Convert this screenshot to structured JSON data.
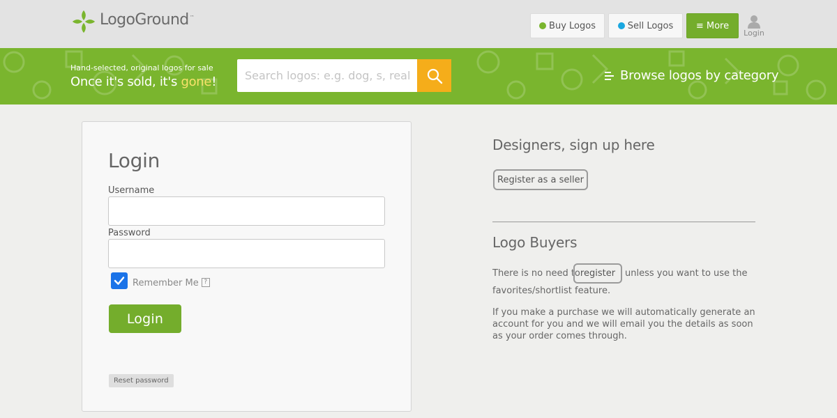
{
  "header": {
    "logo_text": "LogoGround",
    "logo_tm": "™",
    "nav": {
      "buy_label": "Buy Logos",
      "sell_label": "Sell Logos",
      "more_label": "≡ More",
      "login_label": "Login"
    }
  },
  "banner": {
    "tagline_small": "Hand-selected, original logos for sale",
    "tagline_prefix": "Once it's sold, it's ",
    "tagline_highlight": "gone",
    "tagline_suffix": "!",
    "search_placeholder": "Search logos: e.g. dog, s, real estate",
    "browse_label": "Browse logos by category"
  },
  "login_form": {
    "title": "Login",
    "username_label": "Username",
    "username_value": "",
    "password_label": "Password",
    "password_value": "",
    "remember_label": "Remember Me",
    "remember_checked": true,
    "help_symbol": "?",
    "submit_label": "Login",
    "reset_label": "Reset password"
  },
  "designers": {
    "title": "Designers, sign up here",
    "register_label": "Register as a seller"
  },
  "buyers": {
    "title": "Logo Buyers",
    "text_before": "There is no need to",
    "register_label": "register",
    "text_after": "unless you want to use the",
    "text_line2": "favorites/shortlist feature.",
    "paragraph2": "If you make a purchase we will automatically generate an account for you and we will email you the details as soon as your order comes through."
  },
  "colors": {
    "brand_green": "#74ad2c",
    "banner_green": "#7ab52e",
    "search_orange": "#f5ad1a",
    "buy_dot": "#7ab52e",
    "sell_dot": "#1aa7e0",
    "checkbox_blue": "#1a73e8",
    "highlight_yellow": "#f8e26b"
  },
  "icons": {
    "logo": "clover-logo-icon",
    "search": "search-icon",
    "browse": "list-icon",
    "user": "user-icon",
    "checkbox": "checkmark-icon",
    "help": "help-icon"
  }
}
